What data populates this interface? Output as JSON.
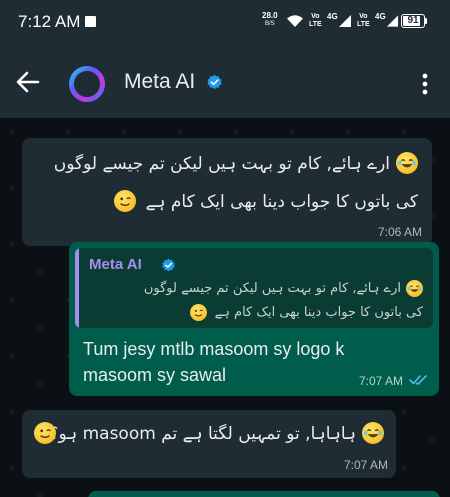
{
  "status_bar": {
    "time": "7:12 AM",
    "net_speed_value": "28.0",
    "net_speed_unit": "B/S",
    "sim1_label_top": "Vo",
    "sim1_label_bottom": "LTE",
    "sim1_gen": "4G",
    "sim2_label_top": "Vo",
    "sim2_label_bottom": "LTE",
    "sim2_gen": "4G",
    "battery": "91"
  },
  "header": {
    "title": "Meta AI",
    "verified": true,
    "icons": [
      "arrow-left-icon",
      "meta-ai-ring-avatar",
      "verified-badge-icon",
      "more-vertical-icon"
    ]
  },
  "messages": [
    {
      "direction": "incoming",
      "line1": "ارے ہائے, کام تو بہت ہیں لیکن تم جیسے لوگوں",
      "line1_emoji": "😂",
      "line2": "کی باتوں کا جواب دینا بھی ایک کام ہے",
      "line2_emoji": "😉",
      "time": "7:06 AM"
    },
    {
      "direction": "outgoing",
      "quote": {
        "author": "Meta AI",
        "verified": true,
        "line1": "ارے ہائے, کام تو بہت ہیں لیکن تم جیسے لوگوں",
        "line1_emoji": "😂",
        "line2": "کی باتوں کا جواب دینا بھی ایک کام ہے",
        "line2_emoji": "😉"
      },
      "text": "Tum jesy mtlb masoom sy logo k masoom sy sawal",
      "time": "7:07 AM",
      "read_status": "double-check-blue"
    },
    {
      "direction": "incoming",
      "line1": "ہاہاہا, تو تمہیں لگتا ہے تم masoom ہو؟",
      "line1_emoji": "😂",
      "trailing_emoji": "😉",
      "time": "7:07 AM"
    }
  ],
  "colors": {
    "header_bg": "#1f2c33",
    "chat_bg": "#0b1014",
    "incoming_bubble": "#202c33",
    "outgoing_bubble": "#005c4b",
    "quote_bg": "#0a3c33",
    "quote_accent": "#a58ef0",
    "read_tick": "#53bdeb",
    "verified": "#1d9bf0"
  }
}
